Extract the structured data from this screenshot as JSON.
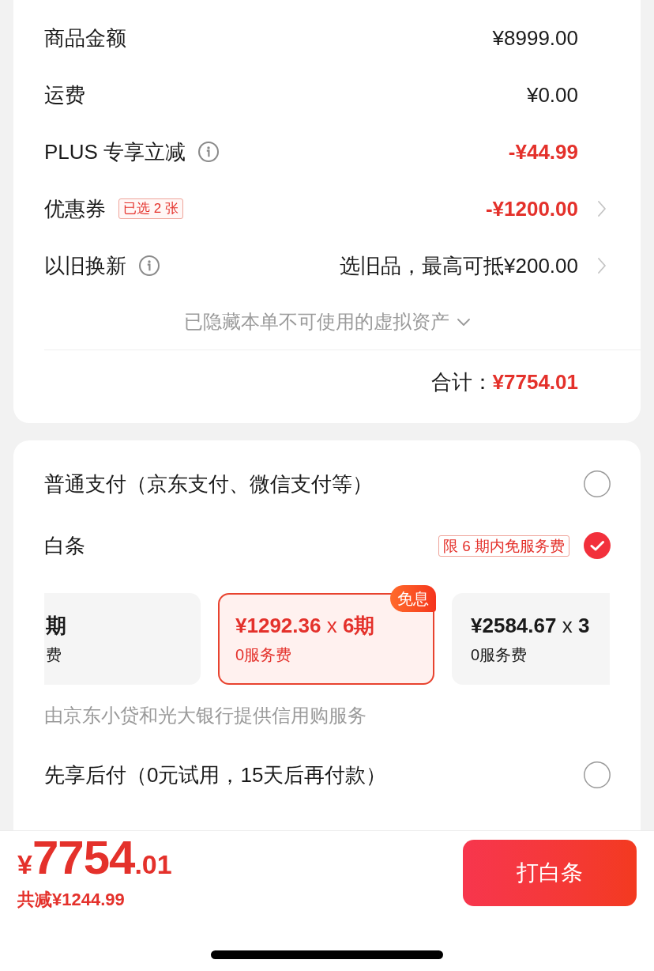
{
  "summary": {
    "rows": [
      {
        "label": "商品金额",
        "info": false,
        "value": "¥8999.00",
        "discount": false,
        "arrow": false
      },
      {
        "label": "运费",
        "info": false,
        "value": "¥0.00",
        "discount": false,
        "arrow": false
      },
      {
        "label": "PLUS 专享立减",
        "info": true,
        "value": "-¥44.99",
        "discount": true,
        "arrow": false
      },
      {
        "label": "优惠券",
        "info": false,
        "tag": "已选 2 张",
        "value": "-¥1200.00",
        "discount": true,
        "arrow": true
      },
      {
        "label": "以旧换新",
        "info": true,
        "value": "选旧品，最高可抵¥200.00",
        "discount": false,
        "arrow": true
      }
    ],
    "hidden_assets": {
      "text": "已隐藏本单不可使用的虚拟资产",
      "expanded": false
    },
    "total": {
      "label": "合计：",
      "value": "¥7754.01"
    }
  },
  "payment": {
    "options": [
      {
        "label": "普通支付（京东支付、微信支付等）",
        "selected": false
      },
      {
        "label": "白条",
        "tag": "限 6 期内免服务费",
        "selected": true,
        "plans": [
          {
            "amount": "**期**",
            "fee": "费",
            "selected": false
          },
          {
            "amount": "**¥1292.36** x **6期**",
            "fee": "0服务费",
            "badge": "免息",
            "selected": true
          },
          {
            "amount": "**¥2584.67** x **3**",
            "fee": "0服务费",
            "selected": false
          }
        ],
        "note": "由京东小贷和光大银行提供信用购服务"
      },
      {
        "label": "先享后付（0元试用，15天后再付款）",
        "selected": false
      }
    ]
  },
  "checkout": {
    "price": {
      "currency": "¥",
      "integer": "7754",
      "decimal": ".01"
    },
    "saved": "共减¥1244.99",
    "button": "打白条"
  }
}
